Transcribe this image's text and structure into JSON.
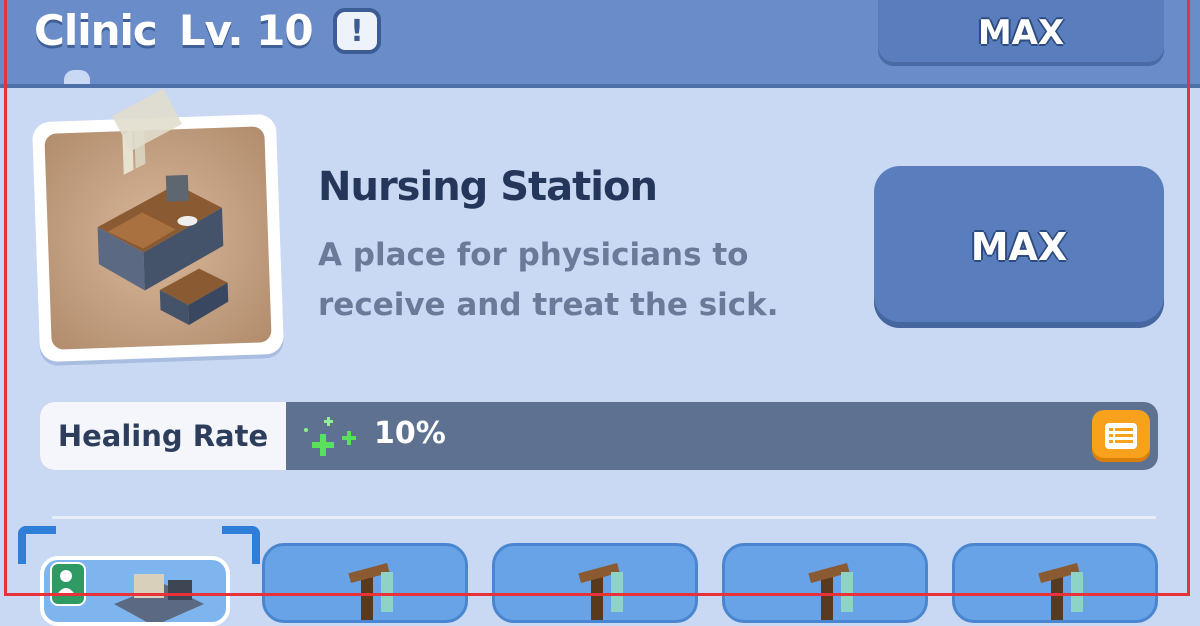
{
  "header": {
    "building_name": "Clinic",
    "level": "Lv. 10",
    "alert_symbol": "!",
    "max_label": "MAX"
  },
  "item": {
    "name": "Nursing Station",
    "description": "A place for physicians to receive and treat the sick.",
    "max_label": "MAX"
  },
  "stat": {
    "label": "Healing Rate",
    "value": "10%",
    "icon": "green-plus-icon"
  },
  "colors": {
    "header_bg": "#6a8cc9",
    "panel_bg": "#c9d8f3",
    "max_button": "#5a7dbd",
    "stat_bar": "#5f7190",
    "list_button": "#f7a11d",
    "slot_bg": "#67a3e6"
  },
  "slots": [
    {
      "state": "selected"
    },
    {
      "state": "available"
    },
    {
      "state": "available"
    },
    {
      "state": "available"
    },
    {
      "state": "available"
    }
  ]
}
